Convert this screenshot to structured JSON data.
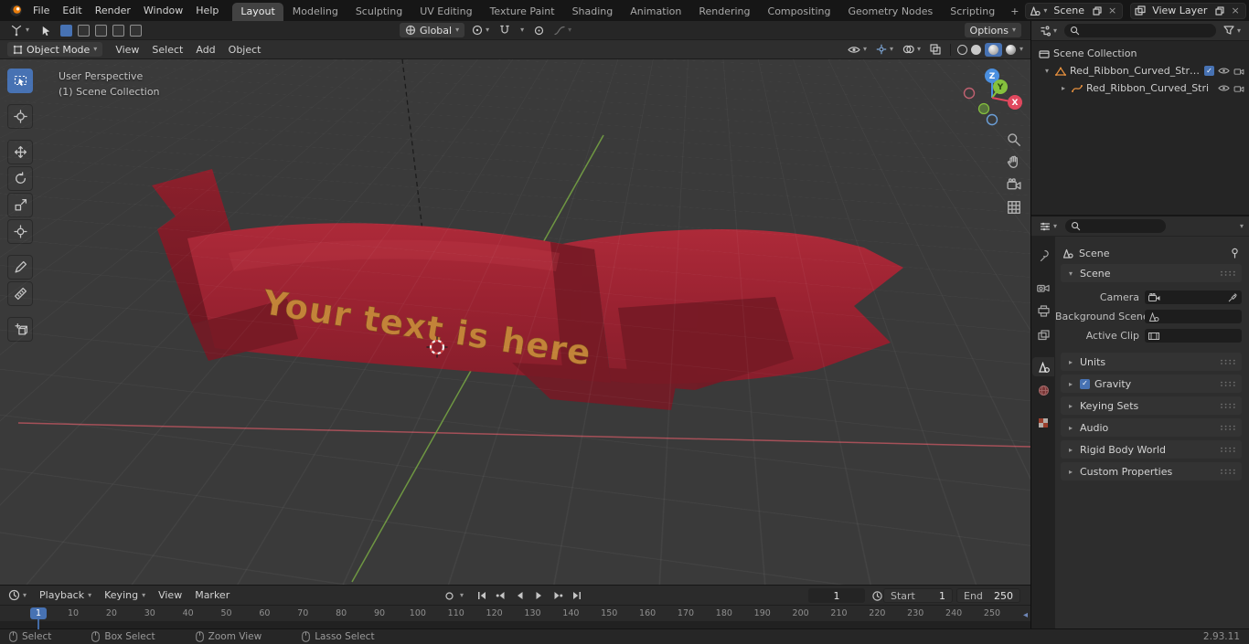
{
  "topbar": {
    "menus": [
      "File",
      "Edit",
      "Render",
      "Window",
      "Help"
    ],
    "workspaces": [
      "Layout",
      "Modeling",
      "Sculpting",
      "UV Editing",
      "Texture Paint",
      "Shading",
      "Animation",
      "Rendering",
      "Compositing",
      "Geometry Nodes",
      "Scripting"
    ],
    "active_workspace": "Layout",
    "add_tab": "+",
    "scene_selector": {
      "label": "Scene"
    },
    "view_layer_selector": {
      "label": "View Layer"
    }
  },
  "tool_settings": {
    "orientation": "Global",
    "options_label": "Options"
  },
  "viewport_header": {
    "mode": "Object Mode",
    "menus": [
      "View",
      "Select",
      "Add",
      "Object"
    ]
  },
  "viewport": {
    "overlay_line1": "User Perspective",
    "overlay_line2": "(1) Scene Collection",
    "ribbon_text": "Your text is here",
    "gizmo": {
      "x_label": "X",
      "y_label": "Y",
      "z_label": "Z"
    }
  },
  "outliner": {
    "root_collection": "Scene Collection",
    "items": [
      {
        "label": "Red_Ribbon_Curved_Stripe_B",
        "icon": "mesh-data-icon"
      },
      {
        "label": "Red_Ribbon_Curved_Stri",
        "icon": "curve-data-icon"
      }
    ]
  },
  "properties": {
    "breadcrumb": "Scene",
    "scene_panel_label": "Scene",
    "fields": [
      {
        "label": "Camera",
        "icon": "camera-icon",
        "eyedropper": true
      },
      {
        "label": "Background Scene",
        "icon": "scene-icon"
      },
      {
        "label": "Active Clip",
        "icon": "clip-icon"
      }
    ],
    "panels": [
      {
        "label": "Units",
        "checkbox": false
      },
      {
        "label": "Gravity",
        "checkbox": true
      },
      {
        "label": "Keying Sets",
        "checkbox": false
      },
      {
        "label": "Audio",
        "checkbox": false
      },
      {
        "label": "Rigid Body World",
        "checkbox": false
      },
      {
        "label": "Custom Properties",
        "checkbox": false
      }
    ]
  },
  "timeline": {
    "menus_left": [
      "Playback",
      "Keying",
      "View",
      "Marker"
    ],
    "current_frame": "1",
    "start_label": "Start",
    "start_value": "1",
    "end_label": "End",
    "end_value": "250",
    "marker_frame": "1",
    "ticks": [
      10,
      20,
      30,
      40,
      50,
      60,
      70,
      80,
      90,
      100,
      110,
      120,
      130,
      140,
      150,
      160,
      170,
      180,
      190,
      200,
      210,
      220,
      230,
      240,
      250
    ]
  },
  "statusbar": {
    "hints": [
      "Select",
      "Box Select",
      "Zoom View",
      "Lasso Select"
    ],
    "version": "2.93.11"
  },
  "colors": {
    "accent": "#4772b3",
    "ribbon_red": "#9c2331",
    "ribbon_dark": "#7a1a26",
    "ribbon_text_gold": "#c6893a",
    "axis_x": "#b8545e",
    "axis_y": "#74a143"
  }
}
